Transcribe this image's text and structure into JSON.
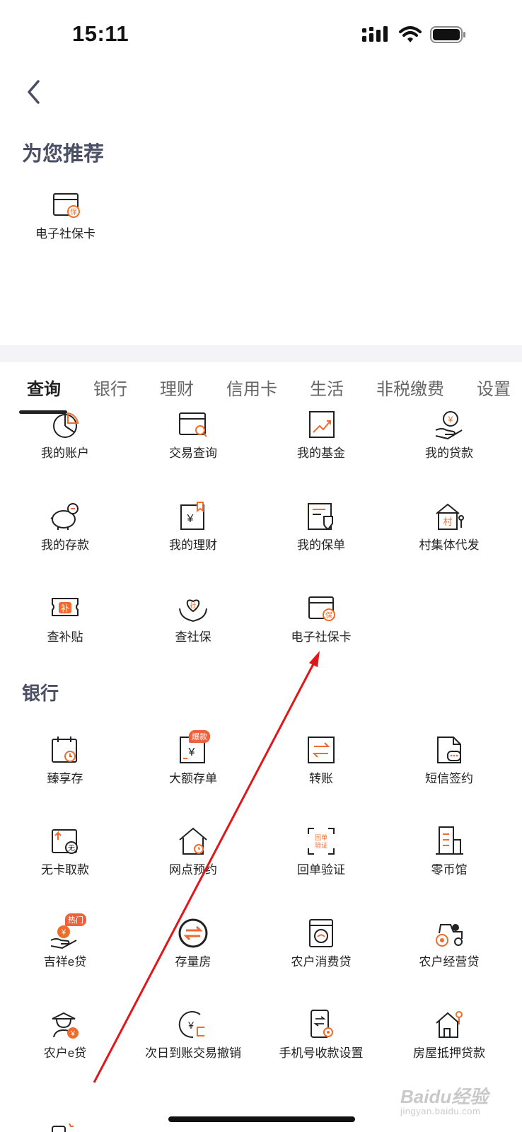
{
  "status_bar": {
    "time": "15:11"
  },
  "recommend": {
    "title": "为您推荐",
    "items": [
      {
        "label": "电子社保卡",
        "icon": "social-security-card-icon"
      }
    ]
  },
  "tabs": [
    {
      "label": "查询",
      "active": true
    },
    {
      "label": "银行"
    },
    {
      "label": "理财"
    },
    {
      "label": "信用卡"
    },
    {
      "label": "生活"
    },
    {
      "label": "非税缴费"
    },
    {
      "label": "设置"
    }
  ],
  "query_items": [
    {
      "label": "我的账户",
      "icon": "pie-chart-icon"
    },
    {
      "label": "交易查询",
      "icon": "card-search-icon"
    },
    {
      "label": "我的基金",
      "icon": "trend-chart-icon"
    },
    {
      "label": "我的贷款",
      "icon": "hand-coin-icon"
    },
    {
      "label": "我的存款",
      "icon": "piggy-bank-icon"
    },
    {
      "label": "我的理财",
      "icon": "wealth-book-icon"
    },
    {
      "label": "我的保单",
      "icon": "policy-shield-icon"
    },
    {
      "label": "村集体代发",
      "icon": "village-house-icon"
    },
    {
      "label": "查补贴",
      "icon": "subsidy-ticket-icon"
    },
    {
      "label": "查社保",
      "icon": "social-hands-icon"
    },
    {
      "label": "电子社保卡",
      "icon": "social-security-card-icon"
    }
  ],
  "bank": {
    "title": "银行",
    "items": [
      {
        "label": "臻享存",
        "icon": "calendar-clock-icon"
      },
      {
        "label": "大额存单",
        "icon": "deposit-certificate-icon",
        "badge": "爆款"
      },
      {
        "label": "转账",
        "icon": "transfer-icon"
      },
      {
        "label": "短信签约",
        "icon": "sms-document-icon"
      },
      {
        "label": "无卡取款",
        "icon": "cardless-withdraw-icon"
      },
      {
        "label": "网点预约",
        "icon": "branch-house-icon"
      },
      {
        "label": "回单验证",
        "icon": "receipt-verify-icon"
      },
      {
        "label": "零币馆",
        "icon": "building-icon"
      },
      {
        "label": "吉祥e贷",
        "icon": "loan-hand-icon",
        "badge": "热门"
      },
      {
        "label": "存量房",
        "icon": "exchange-circle-icon"
      },
      {
        "label": "农户消费贷",
        "icon": "washing-machine-icon"
      },
      {
        "label": "农户经营贷",
        "icon": "tractor-icon"
      },
      {
        "label": "农户e贷",
        "icon": "farmer-coin-icon"
      },
      {
        "label": "次日到账交易撤销",
        "icon": "coin-revoke-icon"
      },
      {
        "label": "手机号收款设置",
        "icon": "phone-settings-icon"
      },
      {
        "label": "房屋抵押贷款",
        "icon": "house-mortgage-icon"
      }
    ]
  },
  "watermark": {
    "brand": "Baidu经验",
    "domain": "jingyan.baidu.com"
  },
  "colors": {
    "accent": "#ef6c2c",
    "title": "#4a4f66",
    "arrow": "#e0161b"
  }
}
